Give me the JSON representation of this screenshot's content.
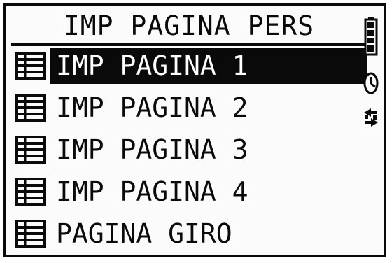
{
  "header": {
    "title": "IMP PAGINA PERS"
  },
  "menu": {
    "items": [
      {
        "label": "IMP PAGINA 1",
        "icon": "page-layout-icon",
        "selected": true
      },
      {
        "label": "IMP PAGINA 2",
        "icon": "page-layout-icon",
        "selected": false
      },
      {
        "label": "IMP PAGINA 3",
        "icon": "page-layout-icon",
        "selected": false
      },
      {
        "label": "IMP PAGINA 4",
        "icon": "page-layout-icon",
        "selected": false
      },
      {
        "label": "PAGINA GIRO",
        "icon": "page-layout-icon",
        "selected": false
      }
    ]
  },
  "status": {
    "battery_icon": "battery-icon",
    "clock_icon": "clock-icon",
    "swap_icon": "swap-arrows-icon"
  },
  "colors": {
    "foreground": "#0a0a0a",
    "background": "#fbfbfb",
    "highlight_text": "#ffffff"
  }
}
